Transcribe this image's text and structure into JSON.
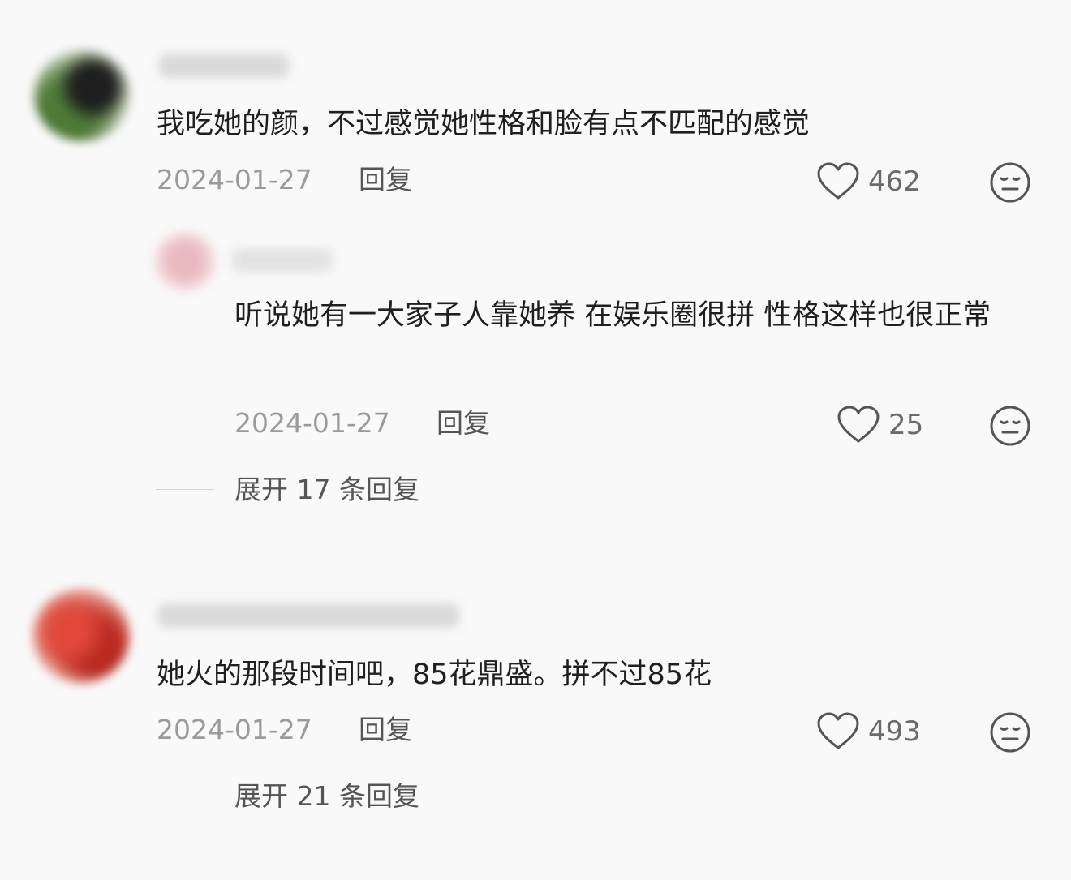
{
  "comments": [
    {
      "text": "我吃她的颜，不过感觉她性格和脸有点不匹配的感觉",
      "date": "2024-01-27",
      "reply_label": "回复",
      "likes": "462",
      "reply": {
        "text": "听说她有一大家子人靠她养 在娱乐圈很拼 性格这样也很正常",
        "date": "2024-01-27",
        "reply_label": "回复",
        "likes": "25"
      },
      "expand_label": "展开 17 条回复"
    },
    {
      "text": "她火的那段时间吧，85花鼎盛。拼不过85花",
      "date": "2024-01-27",
      "reply_label": "回复",
      "likes": "493",
      "expand_label": "展开 21 条回复"
    }
  ],
  "icons": {
    "like": "heart-outline-icon",
    "react": "neutral-face-icon"
  },
  "colors": {
    "background": "#f9f9f9",
    "primary_text": "#1f1f1f",
    "meta_text": "#9a9a9a",
    "secondary_text": "#555555"
  }
}
